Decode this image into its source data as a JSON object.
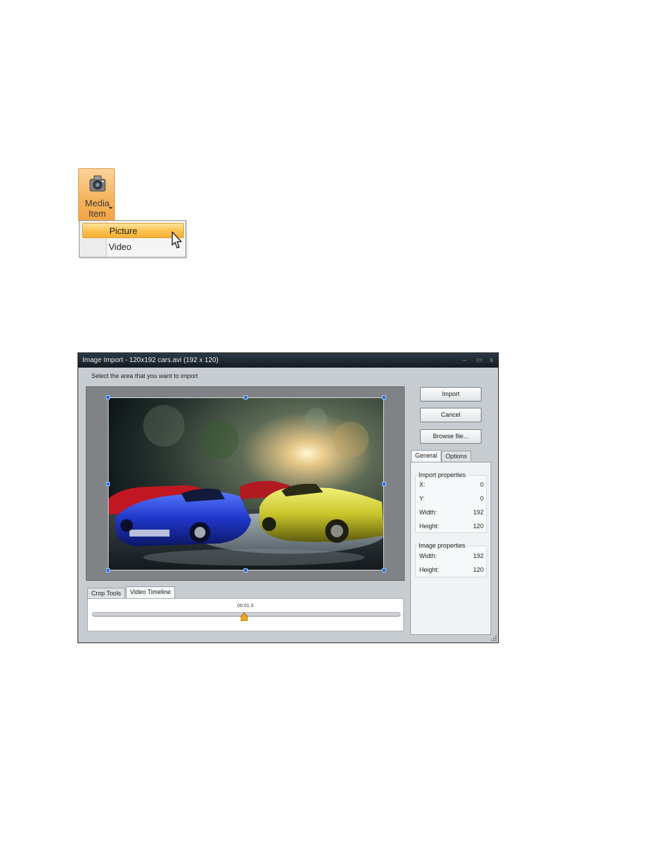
{
  "ribbon": {
    "media_item_line1": "Media",
    "media_item_line2": "Item",
    "menu": [
      "Picture",
      "Video"
    ]
  },
  "dialog": {
    "title": "Image Import - 120x192 cars.avi  (192 x 120)",
    "window_buttons": [
      "–",
      "▭",
      "x"
    ],
    "instruction": "Select the area that you want to import",
    "buttons": {
      "import": "Import",
      "cancel": "Cancel",
      "browse": "Browse file..."
    },
    "right_tabs": [
      "General",
      "Options"
    ],
    "import_properties": {
      "title": "Import properties",
      "rows": [
        {
          "label": "X:",
          "value": "0"
        },
        {
          "label": "Y:",
          "value": "0"
        },
        {
          "label": "Width:",
          "value": "192"
        },
        {
          "label": "Height:",
          "value": "120"
        }
      ]
    },
    "image_properties": {
      "title": "Image properties",
      "rows": [
        {
          "label": "Width:",
          "value": "192"
        },
        {
          "label": "Height:",
          "value": "120"
        }
      ]
    },
    "bottom_tabs": [
      "Crop Tools",
      "Video Timeline"
    ],
    "timeline": {
      "time": "00:01.0",
      "position_fraction": 0.5
    }
  },
  "colors": {
    "accent_orange": "#f6b032",
    "selection_handle": "#1e6fe0",
    "titlebar": "#1c262e"
  }
}
